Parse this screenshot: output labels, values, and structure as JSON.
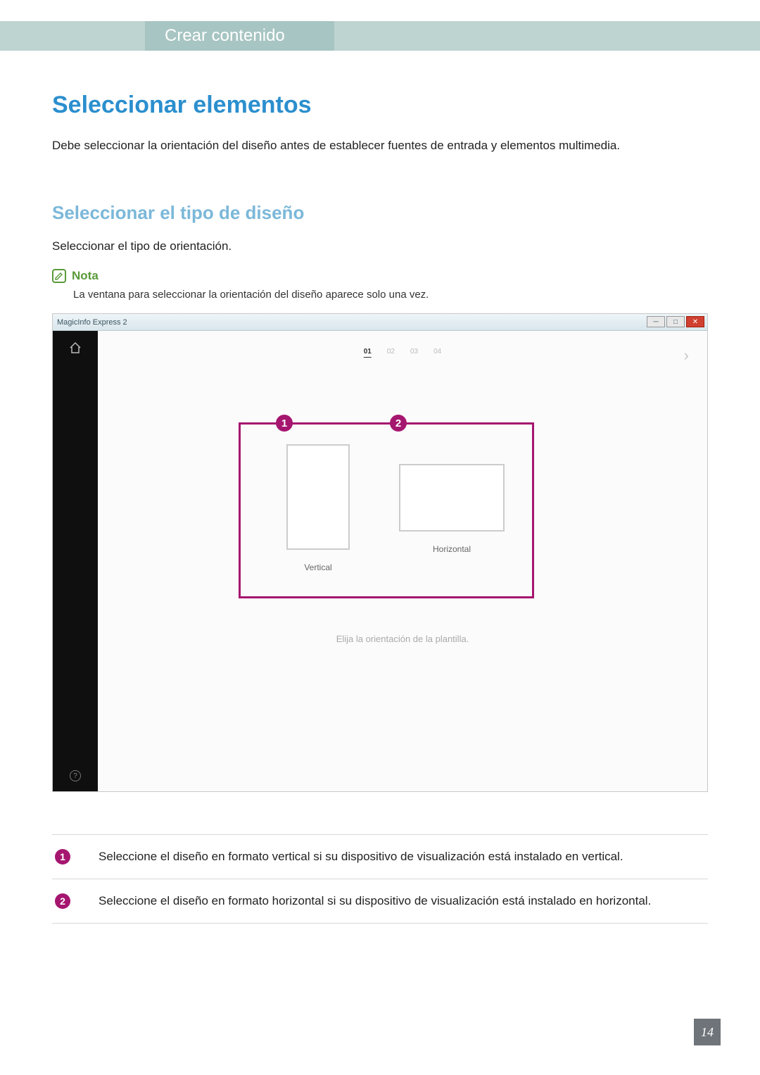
{
  "header": {
    "tab_label": "Crear contenido"
  },
  "section": {
    "title": "Seleccionar elementos",
    "intro": "Debe seleccionar la orientación del diseño antes de establecer fuentes de entrada y elementos multimedia."
  },
  "subsection": {
    "title": "Seleccionar el tipo de diseño",
    "intro": "Seleccionar el tipo de orientación."
  },
  "note": {
    "label": "Nota",
    "text": "La ventana para seleccionar la orientación del diseño aparece solo una vez."
  },
  "mock": {
    "app_title": "MagicInfo Express 2",
    "steps": [
      "01",
      "02",
      "03",
      "04"
    ],
    "orientation_vertical": "Vertical",
    "orientation_horizontal": "Horizontal",
    "hint": "Elija la orientación de la plantilla.",
    "badge1": "1",
    "badge2": "2",
    "help": "?"
  },
  "legend": {
    "row1": {
      "num": "1",
      "text": "Seleccione el diseño en formato vertical si su dispositivo de visualización está instalado en vertical."
    },
    "row2": {
      "num": "2",
      "text": "Seleccione el diseño en formato horizontal si su dispositivo de visualización está instalado en horizontal."
    }
  },
  "page_number": "14"
}
